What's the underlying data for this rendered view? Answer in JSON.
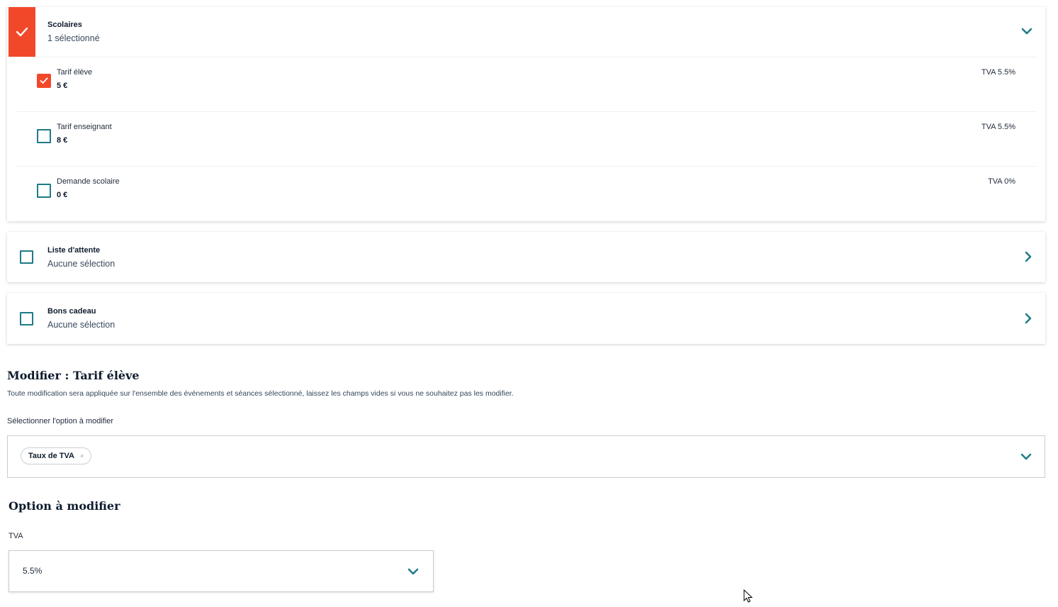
{
  "groups": [
    {
      "title": "Scolaires",
      "subtitle": "1 sélectionné",
      "expanded": true,
      "checked": true,
      "items": [
        {
          "label": "Tarif élève",
          "price": "5 €",
          "tva": "TVA 5.5%",
          "checked": true
        },
        {
          "label": "Tarif enseignant",
          "price": "8 €",
          "tva": "TVA 5.5%",
          "checked": false
        },
        {
          "label": "Demande scolaire",
          "price": "0 €",
          "tva": "TVA 0%",
          "checked": false
        }
      ]
    },
    {
      "title": "Liste d'attente",
      "subtitle": "Aucune sélection",
      "expanded": false,
      "checked": false
    },
    {
      "title": "Bons cadeau",
      "subtitle": "Aucune sélection",
      "expanded": false,
      "checked": false
    }
  ],
  "modify": {
    "title": "Modifier : Tarif élève",
    "description": "Toute modification sera appliquée sur l'ensemble des événements et séances sélectionné, laissez les champs vides si vous ne souhaitez pas les modifier.",
    "select_label": "Sélectionner l'option à modifier",
    "selected_chip": "Taux de TVA",
    "chip_remove": "×"
  },
  "option": {
    "title": "Option à modifier",
    "tva_label": "TVA",
    "tva_value": "5.5%"
  },
  "colors": {
    "accent_red": "#f2482a",
    "teal": "#1e7b86",
    "text_dark": "#0f1c2e"
  },
  "icons": {
    "check": "check-icon",
    "chevron_down": "chevron-down-icon",
    "chevron_right": "chevron-right-icon",
    "cursor": "mouse-cursor-icon"
  }
}
